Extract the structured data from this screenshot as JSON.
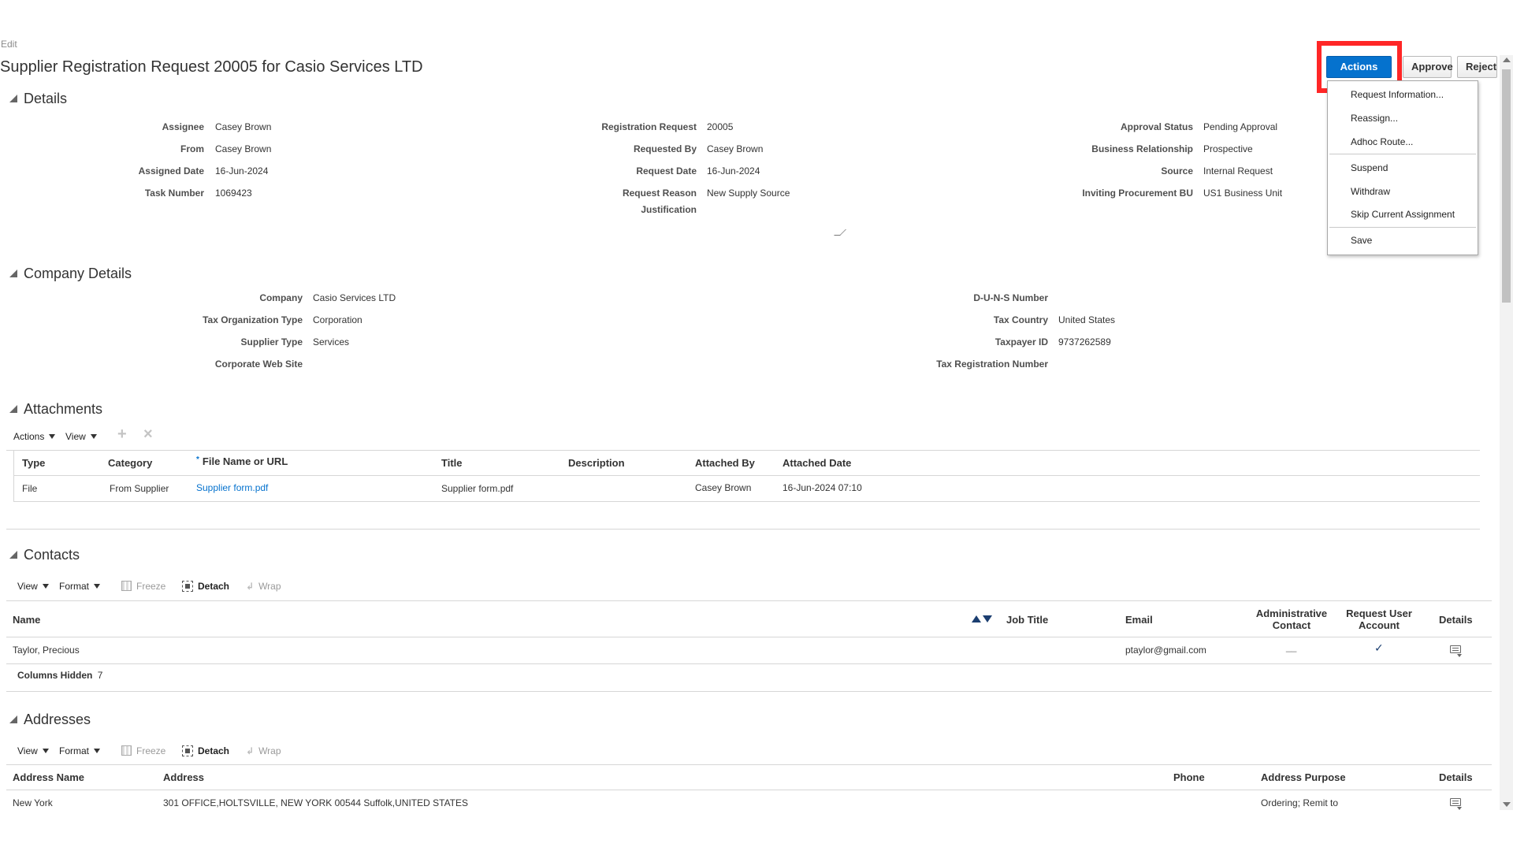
{
  "page": {
    "mode_label": "Edit",
    "title": "Supplier Registration Request 20005 for Casio Services LTD"
  },
  "header_buttons": {
    "actions": "Actions",
    "approve": "Approve",
    "reject": "Reject"
  },
  "actions_menu": {
    "items": [
      "Request Information...",
      "Reassign...",
      "Adhoc Route...",
      "Suspend",
      "Withdraw",
      "Skip Current Assignment",
      "Save"
    ]
  },
  "details": {
    "heading": "Details",
    "col1": [
      {
        "label": "Assignee",
        "value": "Casey Brown"
      },
      {
        "label": "From",
        "value": "Casey Brown"
      },
      {
        "label": "Assigned Date",
        "value": "16-Jun-2024"
      },
      {
        "label": "Task Number",
        "value": "1069423"
      }
    ],
    "col2": [
      {
        "label": "Registration Request",
        "value": "20005"
      },
      {
        "label": "Requested By",
        "value": "Casey Brown"
      },
      {
        "label": "Request Date",
        "value": "16-Jun-2024"
      },
      {
        "label": "Request Reason",
        "value": "New Supply Source"
      },
      {
        "label": "Justification",
        "value": ""
      }
    ],
    "col3": [
      {
        "label": "Approval Status",
        "value": "Pending Approval"
      },
      {
        "label": "Business Relationship",
        "value": "Prospective"
      },
      {
        "label": "Source",
        "value": "Internal Request"
      },
      {
        "label": "Inviting Procurement BU",
        "value": "US1 Business Unit"
      }
    ]
  },
  "company": {
    "heading": "Company Details",
    "col1": [
      {
        "label": "Company",
        "value": "Casio Services LTD"
      },
      {
        "label": "Tax Organization Type",
        "value": "Corporation"
      },
      {
        "label": "Supplier Type",
        "value": "Services"
      },
      {
        "label": "Corporate Web Site",
        "value": ""
      }
    ],
    "col2": [
      {
        "label": "D-U-N-S Number",
        "value": ""
      },
      {
        "label": "Tax Country",
        "value": "United States"
      },
      {
        "label": "Taxpayer ID",
        "value": "9737262589"
      },
      {
        "label": "Tax Registration Number",
        "value": ""
      }
    ]
  },
  "attachments": {
    "heading": "Attachments",
    "toolbar": {
      "actions": "Actions",
      "view": "View"
    },
    "columns": [
      "Type",
      "Category",
      "File Name or URL",
      "Title",
      "Description",
      "Attached By",
      "Attached Date"
    ],
    "required_marker": "*",
    "rows": [
      {
        "type": "File",
        "category": "From Supplier",
        "file": "Supplier form.pdf",
        "title": "Supplier form.pdf",
        "description": "",
        "attached_by": "Casey Brown",
        "attached_date": "16-Jun-2024 07:10"
      }
    ]
  },
  "contacts": {
    "heading": "Contacts",
    "toolbar": {
      "view": "View",
      "format": "Format",
      "freeze": "Freeze",
      "detach": "Detach",
      "wrap": "Wrap"
    },
    "columns": {
      "name": "Name",
      "job_title": "Job Title",
      "email": "Email",
      "admin1": "Administrative",
      "admin2": "Contact",
      "rua1": "Request User",
      "rua2": "Account",
      "details": "Details"
    },
    "rows": [
      {
        "name": "Taylor, Precious",
        "job_title": "",
        "email": "ptaylor@gmail.com",
        "admin": "__",
        "request_user": "✓"
      }
    ],
    "columns_hidden_label": "Columns Hidden",
    "columns_hidden_count": "7"
  },
  "addresses": {
    "heading": "Addresses",
    "toolbar": {
      "view": "View",
      "format": "Format",
      "freeze": "Freeze",
      "detach": "Detach",
      "wrap": "Wrap"
    },
    "columns": {
      "name": "Address Name",
      "address": "Address",
      "phone": "Phone",
      "purpose": "Address Purpose",
      "details": "Details"
    },
    "rows": [
      {
        "name": "New York",
        "address": "301 OFFICE,HOLTSVILLE, NEW YORK 00544 Suffolk,UNITED STATES",
        "phone": "",
        "purpose": "Ordering; Remit to"
      }
    ]
  },
  "colors": {
    "primary": "#0572ce",
    "highlight": "#ff2626",
    "link": "#0572ce"
  }
}
